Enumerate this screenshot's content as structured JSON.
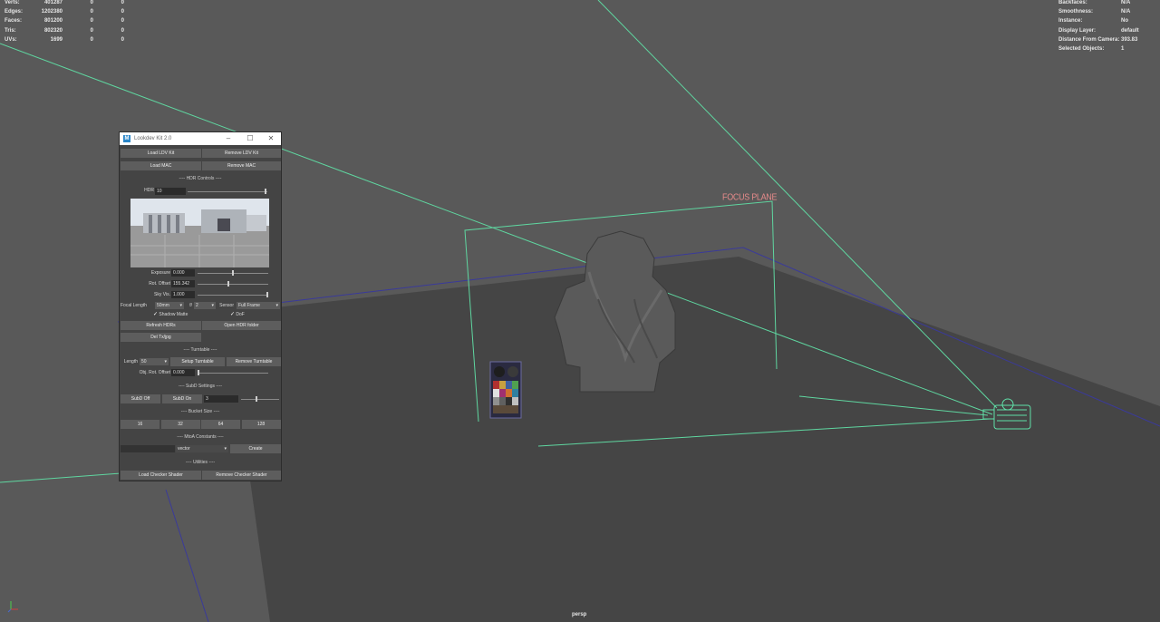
{
  "stats_left": [
    {
      "label": "Verts:",
      "v1": "401287",
      "v2": "0",
      "v3": "0"
    },
    {
      "label": "Edges:",
      "v1": "1202380",
      "v2": "0",
      "v3": "0"
    },
    {
      "label": "Faces:",
      "v1": "801200",
      "v2": "0",
      "v3": "0"
    },
    {
      "label": "Tris:",
      "v1": "802320",
      "v2": "0",
      "v3": "0"
    },
    {
      "label": "UVs:",
      "v1": "1699",
      "v2": "0",
      "v3": "0"
    }
  ],
  "stats_right": [
    {
      "label": "Backfaces:",
      "val": "N/A"
    },
    {
      "label": "Smoothness:",
      "val": "N/A"
    },
    {
      "label": "Instance:",
      "val": "No"
    },
    {
      "label": "Display Layer:",
      "val": "default"
    },
    {
      "label": "Distance From Camera:",
      "val": "393.83"
    },
    {
      "label": "Selected Objects:",
      "val": "1"
    }
  ],
  "viewport": {
    "camera_label": "persp",
    "focus_plane_label": "FOCUS PLANE"
  },
  "window": {
    "title": "Lookdev Kit 2.0",
    "buttons": {
      "load_ldv": "Load LDV Kit",
      "remove_ldv": "Remove LDV Kit",
      "load_mac": "Load MAC",
      "remove_mac": "Remove MAC",
      "refresh_hdrs": "Refresh HDRs",
      "open_hdr_folder": "Open HDR folder",
      "del_tx": "Del Tx/jpg",
      "setup_turntable": "Setup Turntable",
      "remove_turntable": "Remove Turntable",
      "subd_off": "SubD Off",
      "subd_on": "SubD On",
      "create": "Create",
      "load_checker": "Load Checker Shader",
      "remove_checker": "Remove Checker Shader"
    },
    "sections": {
      "hdr": "---- HDR Controls ----",
      "turntable": "---- Turntable ----",
      "subd": "---- SubD Settings ----",
      "bucket": "---- Bucket Size ----",
      "mtoa": "---- MtoA Constants ----",
      "utilities": "---- Utilities ----"
    },
    "hdr": {
      "label": "HDR",
      "value": "10"
    },
    "exposure": {
      "label": "Exposure",
      "value": "0.000",
      "level": 0.5
    },
    "rot_offset": {
      "label": "Rot. Offset",
      "value": "155.342",
      "level": 0.43
    },
    "sky_vis": {
      "label": "Sky Vis.",
      "value": "1.000",
      "level": 1.0
    },
    "focal_length": {
      "label": "Focal Length",
      "value": "50mm"
    },
    "fstop": {
      "label": "f/",
      "value": "2"
    },
    "sensor": {
      "label": "Sensor",
      "value": "Full Frame"
    },
    "shadow_matte": {
      "label": "Shadow Matte",
      "checked": true
    },
    "dof": {
      "label": "DoF",
      "checked": true
    },
    "length": {
      "label": "Length",
      "value": "50"
    },
    "obj_rot_offset": {
      "label": "Obj. Rot. Offset",
      "value": "0.000",
      "level": 0.0
    },
    "subd_level": {
      "value": "3",
      "level": 0.4
    },
    "bucket_sizes": [
      "16",
      "32",
      "64",
      "128"
    ],
    "mtoa": {
      "name_value": "",
      "type": "vector"
    }
  },
  "icons": {
    "window_icon": "maya-logo-icon",
    "minimize": "minimize-icon",
    "maximize": "maximize-icon",
    "close": "close-icon"
  }
}
